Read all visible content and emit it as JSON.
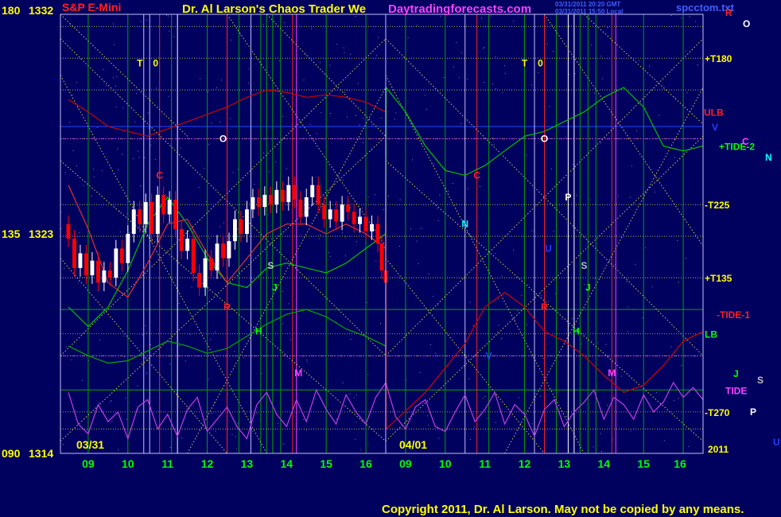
{
  "header": {
    "symbol": "S&P E-Mini",
    "title": "Dr. Al Larson's Chaos Trader We",
    "site": "Daytradingforecasts.com",
    "stamp1": "03/31/2011 20:20 GMT",
    "stamp2": "03/31/2011 15:50 Local",
    "file": "spcctom.txt",
    "corner_o": "O",
    "corner_r": "R"
  },
  "footer": {
    "copyright": "Copyright 2011, Dr. Al Larson. May not be copied by any means."
  },
  "colors": {
    "background": "#00005f",
    "grid": "#00a000",
    "diag": "#c8c850",
    "price_up": "#ffffff",
    "price_down": "#ff0000",
    "ulb": "#d00000",
    "tide2": "#00c000",
    "tide_osc": "#c040e0",
    "title": "#ffff00",
    "site": "#ff40ff",
    "copyright": "#ffff00"
  },
  "chart_data": {
    "type": "line",
    "title": "S&P E-Mini",
    "y_axis_labels": [
      {
        "deg": "180",
        "price": "1332",
        "value": 1332
      },
      {
        "deg": "135",
        "price": "1323",
        "value": 1323
      },
      {
        "deg": "090",
        "price": "1314",
        "value": 1314
      }
    ],
    "ylim": [
      1314,
      1332
    ],
    "date_labels": [
      "03/31",
      "04/01",
      "2011"
    ],
    "x_ticks": [
      "09",
      "10",
      "11",
      "12",
      "13",
      "14",
      "15",
      "16",
      "09",
      "10",
      "11",
      "12",
      "13",
      "14",
      "15",
      "16"
    ],
    "right_labels": [
      {
        "text": "+T180",
        "color": "#ffff00",
        "value": 1330.2
      },
      {
        "text": "ULB",
        "color": "#ff2020",
        "value": 1328.0
      },
      {
        "text": "V",
        "color": "#2040ff",
        "value": 1327.4
      },
      {
        "text": "+TIDE-2",
        "color": "#00ff00",
        "value": 1326.6
      },
      {
        "text": "-T225",
        "color": "#ffff00",
        "value": 1324.2
      },
      {
        "text": "+T135",
        "color": "#ffff00",
        "value": 1321.2
      },
      {
        "text": "-TIDE-1",
        "color": "#ff2020",
        "value": 1319.7
      },
      {
        "text": "LB",
        "color": "#00ff00",
        "value": 1318.9
      },
      {
        "text": "TIDE",
        "color": "#ff40ff",
        "value": 1316.6
      },
      {
        "text": "-T270",
        "color": "#ffff00",
        "value": 1315.7
      },
      {
        "text": "2011",
        "color": "#ffff00",
        "value": 1314.2
      }
    ],
    "planet_letters": [
      {
        "text": "T",
        "color": "#ffff00",
        "x": 1.8,
        "y": 1330.0
      },
      {
        "text": "0",
        "color": "#ffff00",
        "x": 2.2,
        "y": 1330.0
      },
      {
        "text": "O",
        "color": "#ffffff",
        "x": 3.9,
        "y": 1326.9
      },
      {
        "text": "C",
        "color": "#ff2020",
        "x": 2.3,
        "y": 1325.4
      },
      {
        "text": "S",
        "color": "#c0c0c0",
        "x": 5.1,
        "y": 1321.7
      },
      {
        "text": "J",
        "color": "#00ff00",
        "x": 5.2,
        "y": 1320.8
      },
      {
        "text": "R",
        "color": "#ff2020",
        "x": 4.0,
        "y": 1320.0
      },
      {
        "text": "H",
        "color": "#00ff00",
        "x": 4.8,
        "y": 1319.0
      },
      {
        "text": "M",
        "color": "#ff40ff",
        "x": 5.8,
        "y": 1317.3
      },
      {
        "text": "T",
        "color": "#ffff00",
        "x": 11.5,
        "y": 1330.0
      },
      {
        "text": "0",
        "color": "#ffff00",
        "x": 11.9,
        "y": 1330.0
      },
      {
        "text": "O",
        "color": "#ffffff",
        "x": 12.0,
        "y": 1326.9
      },
      {
        "text": "C",
        "color": "#ff2020",
        "x": 10.3,
        "y": 1325.4
      },
      {
        "text": "N",
        "color": "#00ffff",
        "x": 10.0,
        "y": 1323.4
      },
      {
        "text": "P",
        "color": "#ffffff",
        "x": 12.6,
        "y": 1324.5
      },
      {
        "text": "U",
        "color": "#2040ff",
        "x": 12.1,
        "y": 1322.4
      },
      {
        "text": "S",
        "color": "#c0c0c0",
        "x": 13.0,
        "y": 1321.7
      },
      {
        "text": "J",
        "color": "#00ff00",
        "x": 13.1,
        "y": 1320.8
      },
      {
        "text": "R",
        "color": "#ff2020",
        "x": 12.0,
        "y": 1320.0
      },
      {
        "text": "H",
        "color": "#00ff00",
        "x": 12.8,
        "y": 1319.0
      },
      {
        "text": "V",
        "color": "#2040ff",
        "x": 10.6,
        "y": 1318.0
      },
      {
        "text": "M",
        "color": "#ff40ff",
        "x": 13.7,
        "y": 1317.3
      }
    ],
    "side_letters": [
      {
        "text": "C",
        "color": "#ff40ff"
      },
      {
        "text": "N",
        "color": "#00ffff"
      },
      {
        "text": "J",
        "color": "#00ff00"
      },
      {
        "text": "S",
        "color": "#c0c0c0"
      },
      {
        "text": "P",
        "color": "#ffffff"
      },
      {
        "text": "U",
        "color": "#2040ff"
      }
    ],
    "price_series": [
      {
        "x": 0.0,
        "o": 1323.4,
        "c": 1322.8
      },
      {
        "x": 0.15,
        "o": 1322.8,
        "c": 1321.6
      },
      {
        "x": 0.3,
        "o": 1321.6,
        "c": 1322.2
      },
      {
        "x": 0.45,
        "o": 1322.2,
        "c": 1321.3
      },
      {
        "x": 0.6,
        "o": 1321.3,
        "c": 1321.9
      },
      {
        "x": 0.75,
        "o": 1321.9,
        "c": 1321.0
      },
      {
        "x": 0.9,
        "o": 1321.0,
        "c": 1321.5
      },
      {
        "x": 1.05,
        "o": 1321.5,
        "c": 1321.2
      },
      {
        "x": 1.2,
        "o": 1321.2,
        "c": 1322.4
      },
      {
        "x": 1.35,
        "o": 1322.4,
        "c": 1321.8
      },
      {
        "x": 1.5,
        "o": 1321.8,
        "c": 1323.0
      },
      {
        "x": 1.65,
        "o": 1323.0,
        "c": 1324.0
      },
      {
        "x": 1.8,
        "o": 1324.0,
        "c": 1323.4
      },
      {
        "x": 1.95,
        "o": 1323.4,
        "c": 1324.3
      },
      {
        "x": 2.1,
        "o": 1324.3,
        "c": 1323.0
      },
      {
        "x": 2.25,
        "o": 1323.0,
        "c": 1324.6
      },
      {
        "x": 2.4,
        "o": 1324.6,
        "c": 1323.8
      },
      {
        "x": 2.55,
        "o": 1323.8,
        "c": 1324.4
      },
      {
        "x": 2.7,
        "o": 1324.4,
        "c": 1323.2
      },
      {
        "x": 2.85,
        "o": 1323.2,
        "c": 1322.3
      },
      {
        "x": 3.0,
        "o": 1322.3,
        "c": 1322.8
      },
      {
        "x": 3.15,
        "o": 1322.8,
        "c": 1321.4
      },
      {
        "x": 3.3,
        "o": 1321.4,
        "c": 1320.8
      },
      {
        "x": 3.45,
        "o": 1320.8,
        "c": 1322.0
      },
      {
        "x": 3.6,
        "o": 1322.0,
        "c": 1321.5
      },
      {
        "x": 3.75,
        "o": 1321.5,
        "c": 1322.6
      },
      {
        "x": 3.9,
        "o": 1322.6,
        "c": 1322.0
      },
      {
        "x": 4.05,
        "o": 1322.0,
        "c": 1322.7
      },
      {
        "x": 4.2,
        "o": 1322.7,
        "c": 1323.6
      },
      {
        "x": 4.35,
        "o": 1323.6,
        "c": 1323.0
      },
      {
        "x": 4.5,
        "o": 1323.0,
        "c": 1324.0
      },
      {
        "x": 4.65,
        "o": 1324.0,
        "c": 1324.5
      },
      {
        "x": 4.8,
        "o": 1324.5,
        "c": 1324.1
      },
      {
        "x": 4.95,
        "o": 1324.1,
        "c": 1324.6
      },
      {
        "x": 5.1,
        "o": 1324.6,
        "c": 1324.2
      },
      {
        "x": 5.25,
        "o": 1324.2,
        "c": 1324.8
      },
      {
        "x": 5.4,
        "o": 1324.8,
        "c": 1324.3
      },
      {
        "x": 5.55,
        "o": 1324.3,
        "c": 1325.0
      },
      {
        "x": 5.7,
        "o": 1325.0,
        "c": 1324.4
      },
      {
        "x": 5.85,
        "o": 1324.4,
        "c": 1323.7
      },
      {
        "x": 6.0,
        "o": 1323.7,
        "c": 1324.5
      },
      {
        "x": 6.15,
        "o": 1324.5,
        "c": 1325.0
      },
      {
        "x": 6.3,
        "o": 1325.0,
        "c": 1324.2
      },
      {
        "x": 6.45,
        "o": 1324.2,
        "c": 1323.6
      },
      {
        "x": 6.6,
        "o": 1323.6,
        "c": 1324.0
      },
      {
        "x": 6.75,
        "o": 1324.0,
        "c": 1323.5
      },
      {
        "x": 6.9,
        "o": 1323.5,
        "c": 1324.2
      },
      {
        "x": 7.05,
        "o": 1324.2,
        "c": 1323.9
      },
      {
        "x": 7.2,
        "o": 1323.9,
        "c": 1323.4
      },
      {
        "x": 7.35,
        "o": 1323.4,
        "c": 1323.7
      },
      {
        "x": 7.5,
        "o": 1323.7,
        "c": 1323.1
      },
      {
        "x": 7.65,
        "o": 1323.1,
        "c": 1323.4
      },
      {
        "x": 7.8,
        "o": 1323.4,
        "c": 1322.6
      },
      {
        "x": 7.9,
        "o": 1322.6,
        "c": 1321.5
      },
      {
        "x": 8.0,
        "o": 1321.5,
        "c": 1321.0
      }
    ],
    "series": [
      {
        "name": "ULB",
        "color": "#d00000",
        "x": [
          0,
          0.5,
          1.0,
          1.5,
          2.0,
          2.5,
          3.0,
          3.5,
          4.0,
          4.5,
          5.0,
          5.5,
          6.0,
          6.5,
          7.0,
          7.5,
          8.0,
          8.01,
          9.0,
          10.0,
          10.5,
          11.0,
          11.5,
          12.0,
          12.5,
          13.0,
          13.5,
          14.0,
          14.5,
          15.0,
          15.5,
          16.0
        ],
        "values": [
          1328.5,
          1328.0,
          1327.4,
          1327.2,
          1327.0,
          1327.3,
          1327.6,
          1327.9,
          1328.2,
          1328.6,
          1328.9,
          1328.8,
          1328.6,
          1328.7,
          1328.6,
          1328.4,
          1328.0,
          1315.0,
          1316.5,
          1318.5,
          1320.0,
          1320.6,
          1320.0,
          1319.0,
          1318.6,
          1318.0,
          1317.2,
          1316.5,
          1316.8,
          1317.6,
          1318.6,
          1319.0
        ]
      },
      {
        "name": "+TIDE-2",
        "color": "#00c000",
        "x": [
          0,
          0.5,
          1.0,
          1.5,
          2.0,
          2.5,
          3.0,
          3.5,
          4.0,
          4.5,
          5.0,
          5.5,
          6.0,
          6.5,
          7.0,
          7.5,
          8.0,
          8.01,
          8.5,
          9.0,
          9.5,
          10.0,
          10.5,
          11.0,
          11.5,
          12.0,
          12.5,
          13.0,
          13.5,
          14.0,
          14.5,
          15.0,
          15.5,
          16.0
        ],
        "values": [
          1320.0,
          1319.2,
          1320.0,
          1321.5,
          1323.4,
          1324.5,
          1323.4,
          1322.0,
          1321.0,
          1320.8,
          1321.6,
          1321.8,
          1321.6,
          1321.4,
          1321.8,
          1322.4,
          1323.0,
          1329.0,
          1328.0,
          1326.6,
          1325.6,
          1325.4,
          1325.8,
          1326.4,
          1327.0,
          1327.2,
          1327.6,
          1328.0,
          1328.6,
          1329.0,
          1328.2,
          1326.6,
          1326.4,
          1326.6
        ]
      },
      {
        "name": "LB",
        "color": "#00a800",
        "x": [
          0,
          0.5,
          1.0,
          1.5,
          2.0,
          2.5,
          3.0,
          3.5,
          4.0,
          4.5,
          5.0,
          5.5,
          6.0,
          6.5,
          7.0,
          7.5,
          8.0
        ],
        "values": [
          1318.4,
          1318.0,
          1317.7,
          1317.8,
          1318.2,
          1318.6,
          1318.4,
          1318.1,
          1318.3,
          1318.8,
          1319.3,
          1319.7,
          1319.9,
          1319.6,
          1319.1,
          1318.8,
          1318.4
        ]
      },
      {
        "name": "-TIDE-1",
        "color": "#e03030",
        "x": [
          0,
          0.5,
          1.0,
          1.5,
          2.0,
          2.5,
          3.0,
          3.5,
          4.0,
          4.5,
          5.0,
          5.5,
          6.0,
          6.5,
          7.0,
          7.5,
          8.0
        ],
        "values": [
          1325.0,
          1323.2,
          1321.0,
          1320.4,
          1321.8,
          1323.4,
          1323.6,
          1322.2,
          1321.0,
          1322.0,
          1323.0,
          1323.4,
          1323.4,
          1323.0,
          1323.4,
          1323.0,
          1322.4
        ]
      },
      {
        "name": "TIDE",
        "color": "#c040e0",
        "x": [
          0,
          0.25,
          0.5,
          0.75,
          1.0,
          1.25,
          1.5,
          1.75,
          2.0,
          2.25,
          2.5,
          2.75,
          3.0,
          3.25,
          3.5,
          3.75,
          4.0,
          4.25,
          4.5,
          4.75,
          5.0,
          5.25,
          5.5,
          5.75,
          6.0,
          6.25,
          6.5,
          6.75,
          7.0,
          7.25,
          7.5,
          7.75,
          8.0,
          8.25,
          8.5,
          8.75,
          9.0,
          9.25,
          9.5,
          9.75,
          10.0,
          10.25,
          10.5,
          10.75,
          11.0,
          11.25,
          11.5,
          11.75,
          12.0,
          12.25,
          12.5,
          12.75,
          13.0,
          13.25,
          13.5,
          13.75,
          14.0,
          14.25,
          14.5,
          14.75,
          15.0,
          15.25,
          15.5,
          15.75,
          16.0
        ],
        "values": [
          1316.5,
          1315.2,
          1314.8,
          1316.0,
          1315.3,
          1315.7,
          1314.6,
          1315.9,
          1316.2,
          1315.0,
          1315.6,
          1314.7,
          1315.8,
          1316.3,
          1314.9,
          1315.4,
          1315.9,
          1315.1,
          1314.6,
          1316.0,
          1316.5,
          1315.6,
          1315.1,
          1316.2,
          1315.3,
          1316.6,
          1315.8,
          1315.2,
          1316.4,
          1315.7,
          1315.2,
          1316.3,
          1316.9,
          1315.5,
          1315.0,
          1315.9,
          1316.2,
          1315.1,
          1314.9,
          1315.7,
          1316.4,
          1315.3,
          1315.8,
          1316.5,
          1315.2,
          1316.0,
          1315.6,
          1314.7,
          1315.8,
          1316.2,
          1315.1,
          1315.7,
          1316.1,
          1316.6,
          1315.4,
          1316.3,
          1316.0,
          1315.4,
          1316.4,
          1315.7,
          1316.1,
          1316.9,
          1316.3,
          1316.7,
          1316.2
        ]
      }
    ],
    "grid": true,
    "legend": "right"
  }
}
